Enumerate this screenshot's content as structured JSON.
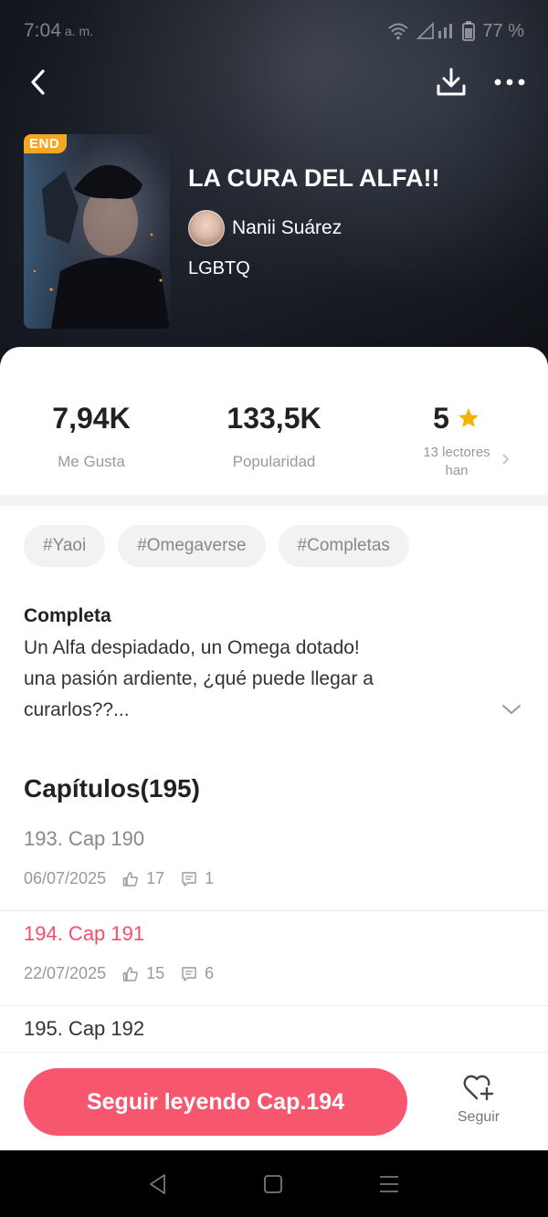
{
  "status_bar": {
    "time": "7:04",
    "ampm": "a. m.",
    "battery": "77 %"
  },
  "book": {
    "badge": "END",
    "title": "LA CURA DEL ALFA!!",
    "author": "Nanii Suárez",
    "genre": "LGBTQ"
  },
  "stats": {
    "likes_value": "7,94K",
    "likes_label": "Me Gusta",
    "popularity_value": "133,5K",
    "popularity_label": "Popularidad",
    "rating_value": "5",
    "rating_label_line1": "13 lectores",
    "rating_label_line2": "han"
  },
  "tags": [
    "#Yaoi",
    "#Omegaverse",
    "#Completas"
  ],
  "description": {
    "status": "Completa",
    "line1": "Un Alfa despiadado, un Omega dotado!",
    "line2": "una pasión ardiente, ¿qué puede llegar a",
    "line3": "curarlos??..."
  },
  "chapters": {
    "header": "Capítulos(195)",
    "items": [
      {
        "title": "193. Cap 190",
        "date": "06/07/2025",
        "likes": "17",
        "comments": "1",
        "state": "read"
      },
      {
        "title": "194. Cap 191",
        "date": "22/07/2025",
        "likes": "15",
        "comments": "6",
        "state": "current"
      },
      {
        "title": "195. Cap 192",
        "state": "unread"
      }
    ]
  },
  "bottom": {
    "read_button": "Seguir leyendo Cap.194",
    "follow_label": "Seguir"
  },
  "colors": {
    "accent": "#f7566f",
    "current_chapter": "#f24e6e",
    "badge": "#f5a623",
    "star": "#f5b301"
  },
  "icons": [
    "back-icon",
    "download-icon",
    "more-icon",
    "star-icon",
    "chevron-right-icon",
    "chevron-down-icon",
    "thumbs-up-icon",
    "comment-icon",
    "heart-plus-icon",
    "nav-back-icon",
    "nav-home-icon",
    "nav-menu-icon"
  ]
}
